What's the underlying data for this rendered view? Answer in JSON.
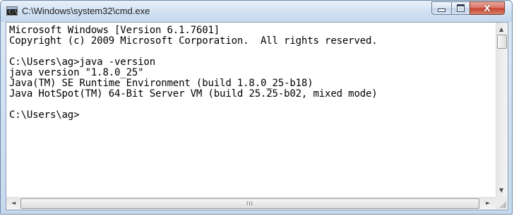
{
  "window": {
    "title": "C:\\Windows\\system32\\cmd.exe",
    "icon": "cmd-icon",
    "icon_text": "C:\\"
  },
  "controls": {
    "minimize_icon": "minimize-icon",
    "maximize_icon": "maximize-icon",
    "close_icon": "close-icon",
    "close_glyph": "X"
  },
  "console": {
    "lines": [
      "Microsoft Windows [Version 6.1.7601]",
      "Copyright (c) 2009 Microsoft Corporation.  All rights reserved.",
      "",
      "C:\\Users\\ag>java -version",
      "java version \"1.8.0_25\"",
      "Java(TM) SE Runtime Environment (build 1.8.0_25-b18)",
      "Java HotSpot(TM) 64-Bit Server VM (build 25.25-b02, mixed mode)",
      "",
      "C:\\Users\\ag>"
    ]
  },
  "scrollbars": {
    "up_arrow": "▲",
    "down_arrow": "▼",
    "left_arrow": "◄",
    "right_arrow": "►",
    "grip": "III"
  },
  "colors": {
    "title_bar": "#d2e2f3",
    "close_button": "#c8442f",
    "console_background": "#ffffff",
    "console_text": "#000000"
  }
}
